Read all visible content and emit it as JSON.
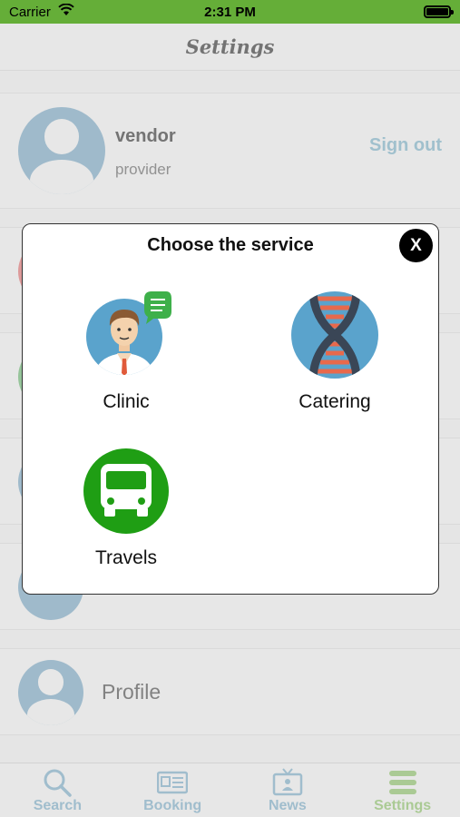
{
  "status_bar": {
    "carrier": "Carrier",
    "time": "2:31 PM"
  },
  "header": {
    "title": "Settings"
  },
  "user": {
    "name": "vendor",
    "role": "provider",
    "signout_label": "Sign out"
  },
  "rows": [
    {
      "label": "",
      "icon": "red-circle-icon",
      "color": "#e9a3a3"
    },
    {
      "label": "",
      "icon": "green-circle-icon",
      "color": "#9fcfa3"
    },
    {
      "label": "",
      "icon": "blue-circle-icon",
      "color": "#a8c5d6"
    },
    {
      "label": "",
      "icon": "blue-circle-icon",
      "color": "#a8c5d6"
    },
    {
      "label": "Profile",
      "icon": "profile-icon",
      "color": "#a8c5d6"
    }
  ],
  "tabs": [
    {
      "label": "Search",
      "icon": "search-icon",
      "active": false
    },
    {
      "label": "Booking",
      "icon": "booking-icon",
      "active": false
    },
    {
      "label": "News",
      "icon": "news-icon",
      "active": false
    },
    {
      "label": "Settings",
      "icon": "settings-icon",
      "active": true
    }
  ],
  "modal": {
    "title": "Choose the service",
    "close_label": "X",
    "services": [
      {
        "label": "Clinic",
        "icon": "doctor-icon"
      },
      {
        "label": "Catering",
        "icon": "dna-icon"
      },
      {
        "label": "Travels",
        "icon": "bus-icon"
      }
    ]
  },
  "colors": {
    "status_bar": "#6bb83c",
    "accent_blue": "#a9cbd9",
    "accent_green": "#b4d59c",
    "bus_green": "#1f9e14",
    "avatar_blue": "#5aa3cc"
  }
}
